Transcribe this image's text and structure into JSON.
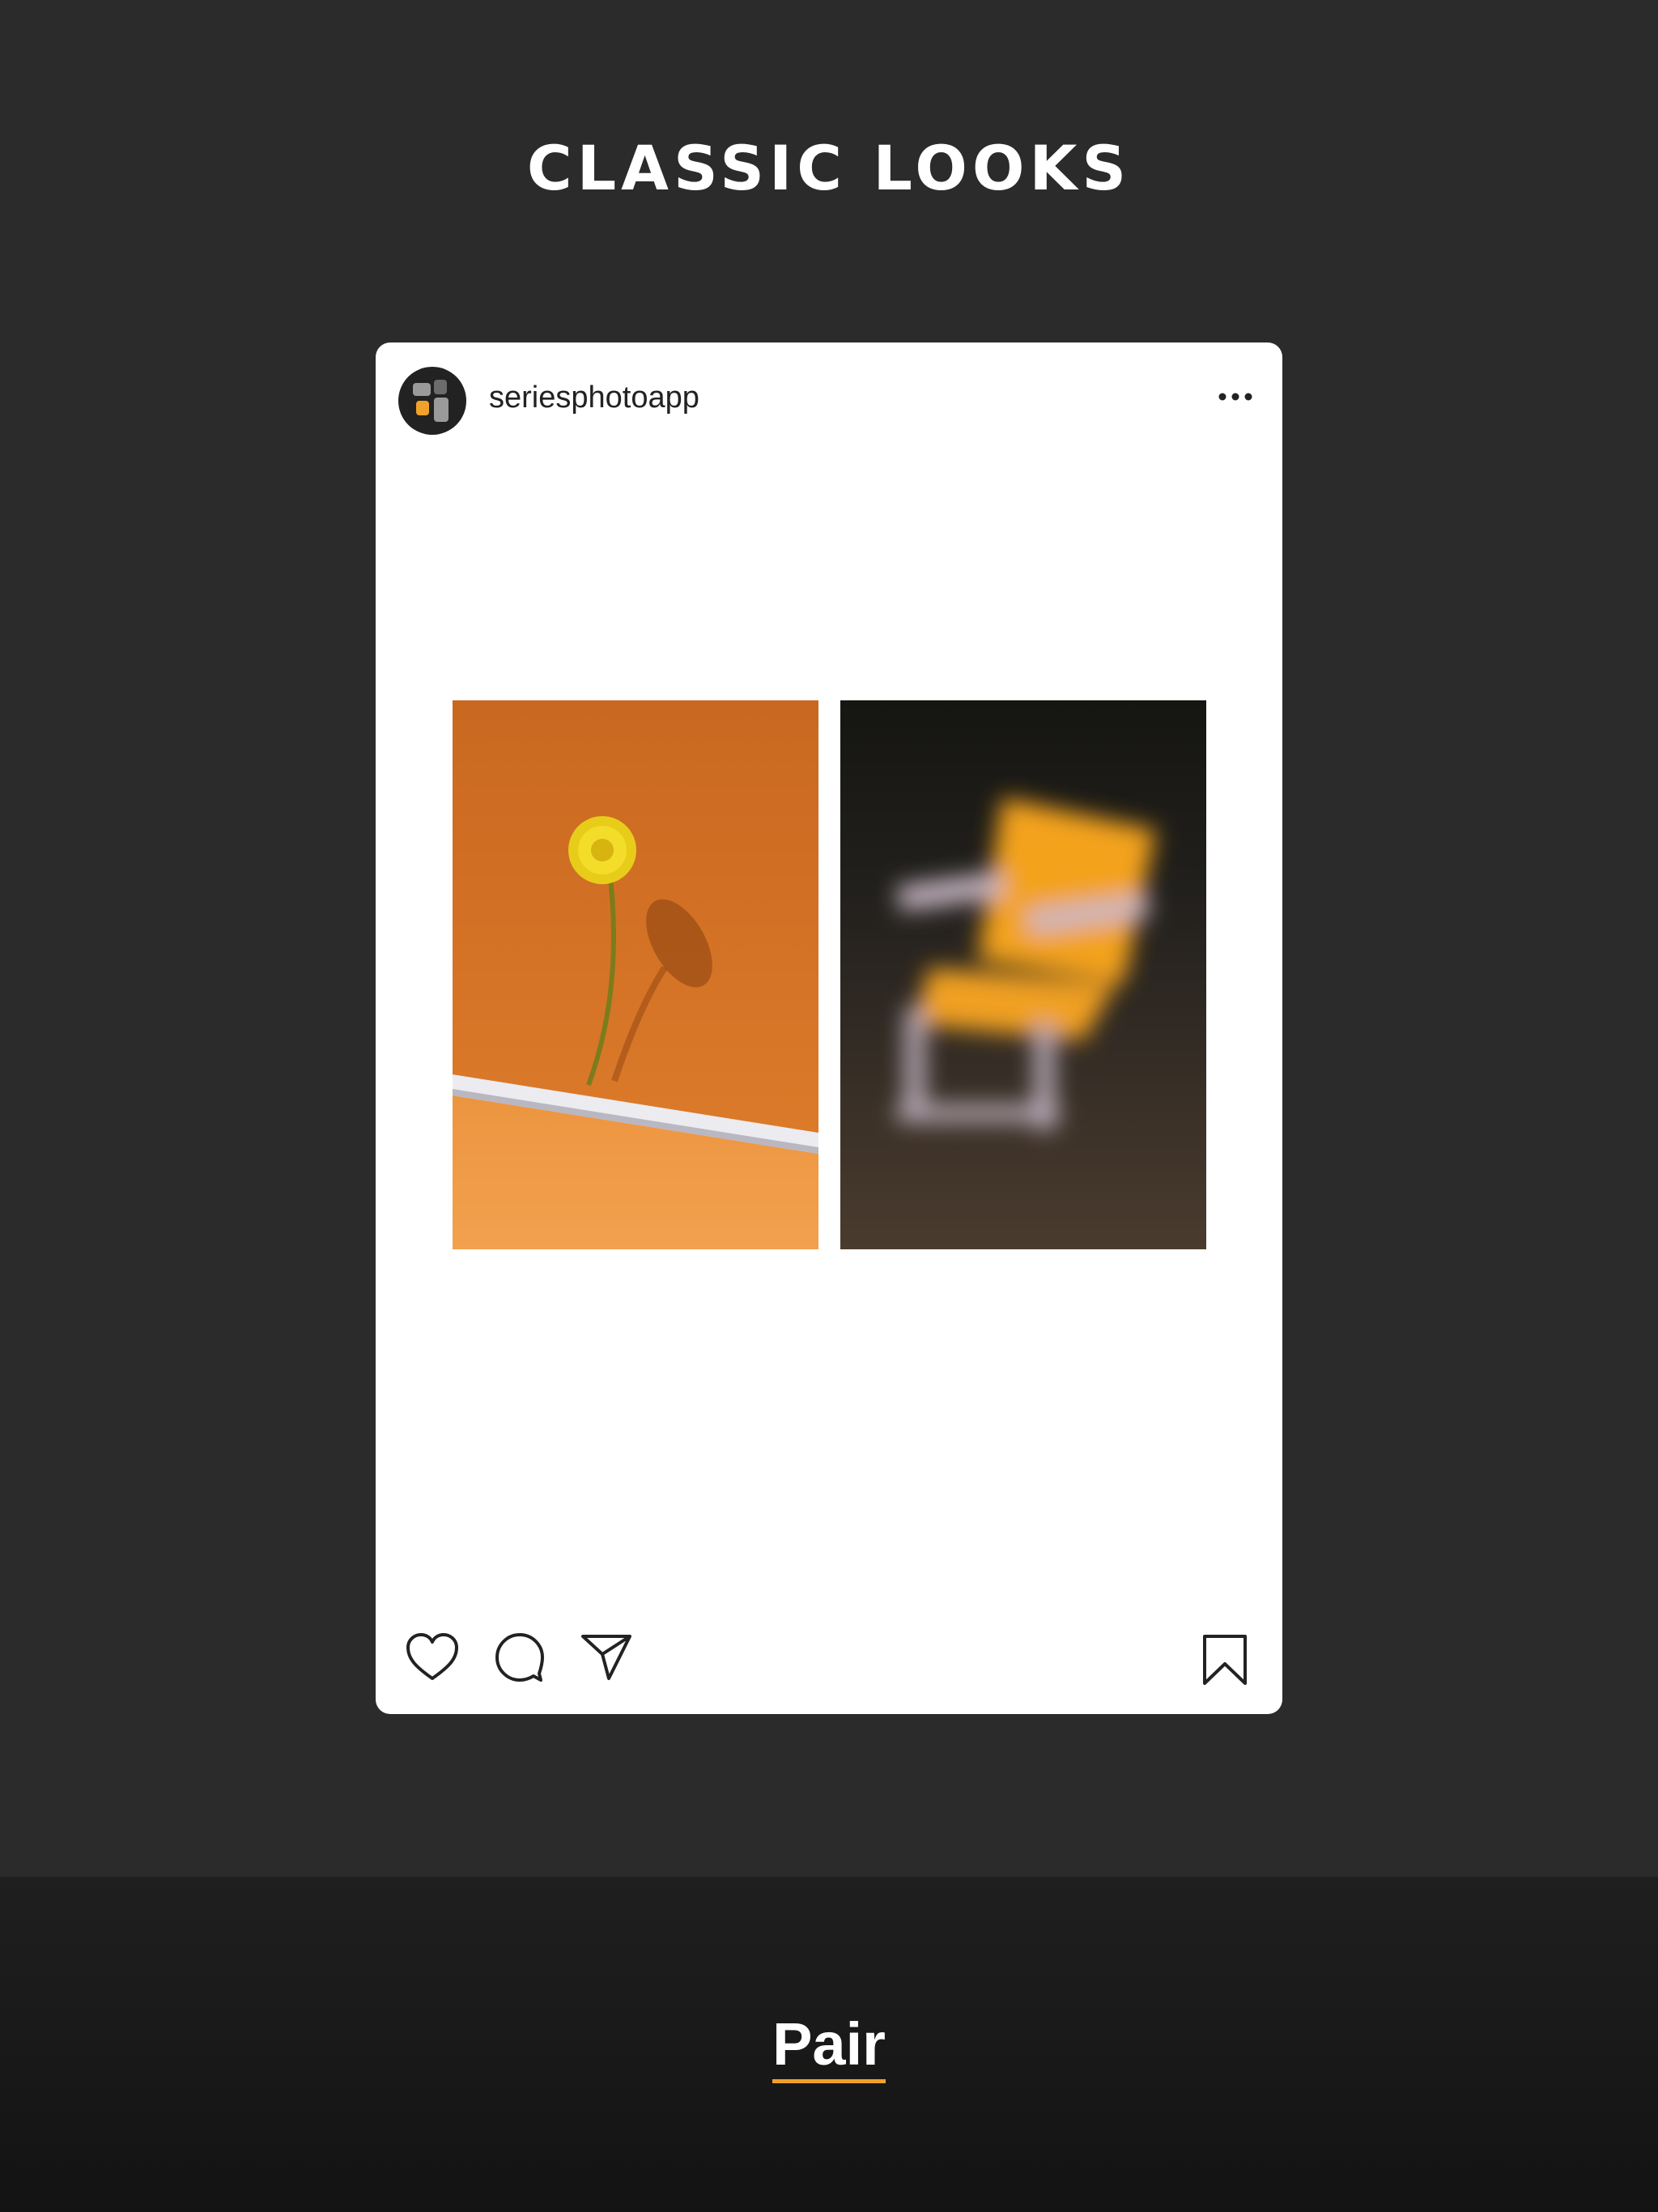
{
  "headline": "CLASSIC LOOKS",
  "post": {
    "username": "seriesphotoapp",
    "avatar_icon": "app-logo-icon",
    "more_icon": "more-dots-icon",
    "photos": [
      {
        "subject": "dandelion-on-orange"
      },
      {
        "subject": "blurred-orange-chair"
      }
    ],
    "actions": {
      "like_icon": "heart-icon",
      "comment_icon": "comment-icon",
      "share_icon": "send-icon",
      "save_icon": "bookmark-icon"
    }
  },
  "bottom_tab": {
    "label": "Pair",
    "accent": "#f0a12a"
  },
  "colors": {
    "background": "#2b2b2b",
    "card": "#ffffff",
    "accent": "#f0a12a"
  }
}
